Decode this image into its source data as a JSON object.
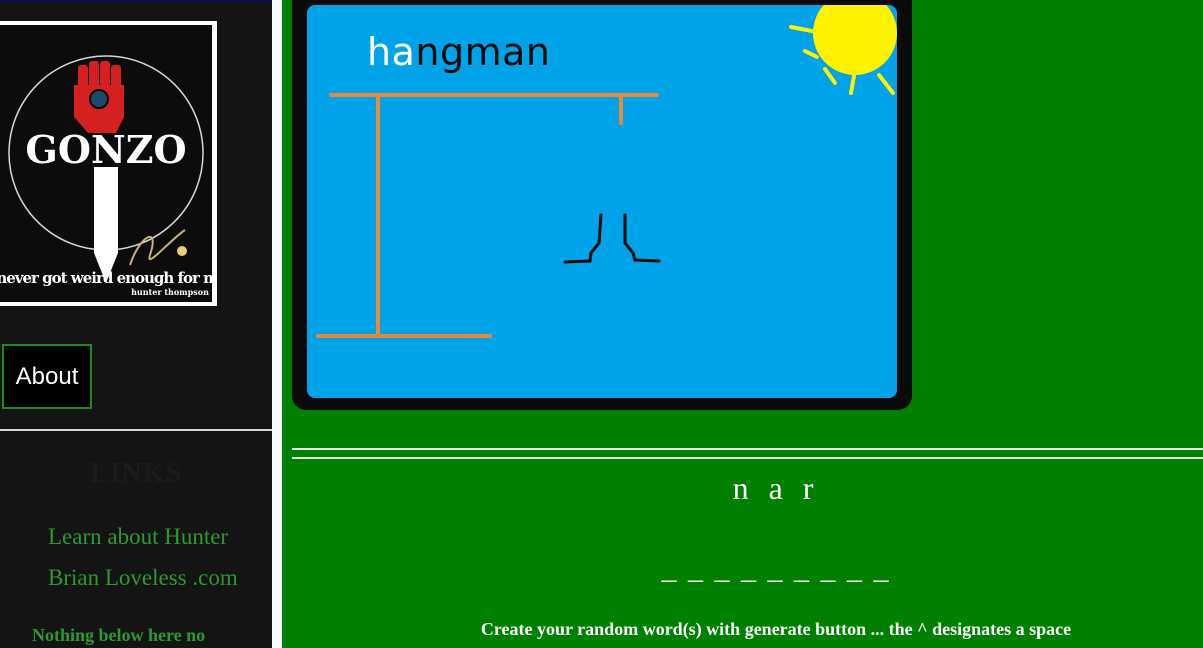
{
  "sidebar": {
    "poster": {
      "title": "GONZO",
      "quote": "it never got weird enough for me",
      "author": "hunter thompson"
    },
    "about_label": "About",
    "links_heading": "LINKS",
    "links": [
      {
        "label": "Learn about Hunter"
      },
      {
        "label": "Brian Loveless .com"
      }
    ],
    "footer_note": "Nothing below here no"
  },
  "game": {
    "title_prefix": "ha",
    "title_suffix": "ngman",
    "guessed_letters": "n a r",
    "word_blanks": "_ _ _ _ _ _ _ _ _",
    "instructions": "Create your random word(s) with generate button ... the ^ designates a space"
  },
  "colors": {
    "page_bg": "#008000",
    "sky": "#00a2e8",
    "sun": "#fff200",
    "gallows": "#e88a3a",
    "fist": "#d42020"
  }
}
